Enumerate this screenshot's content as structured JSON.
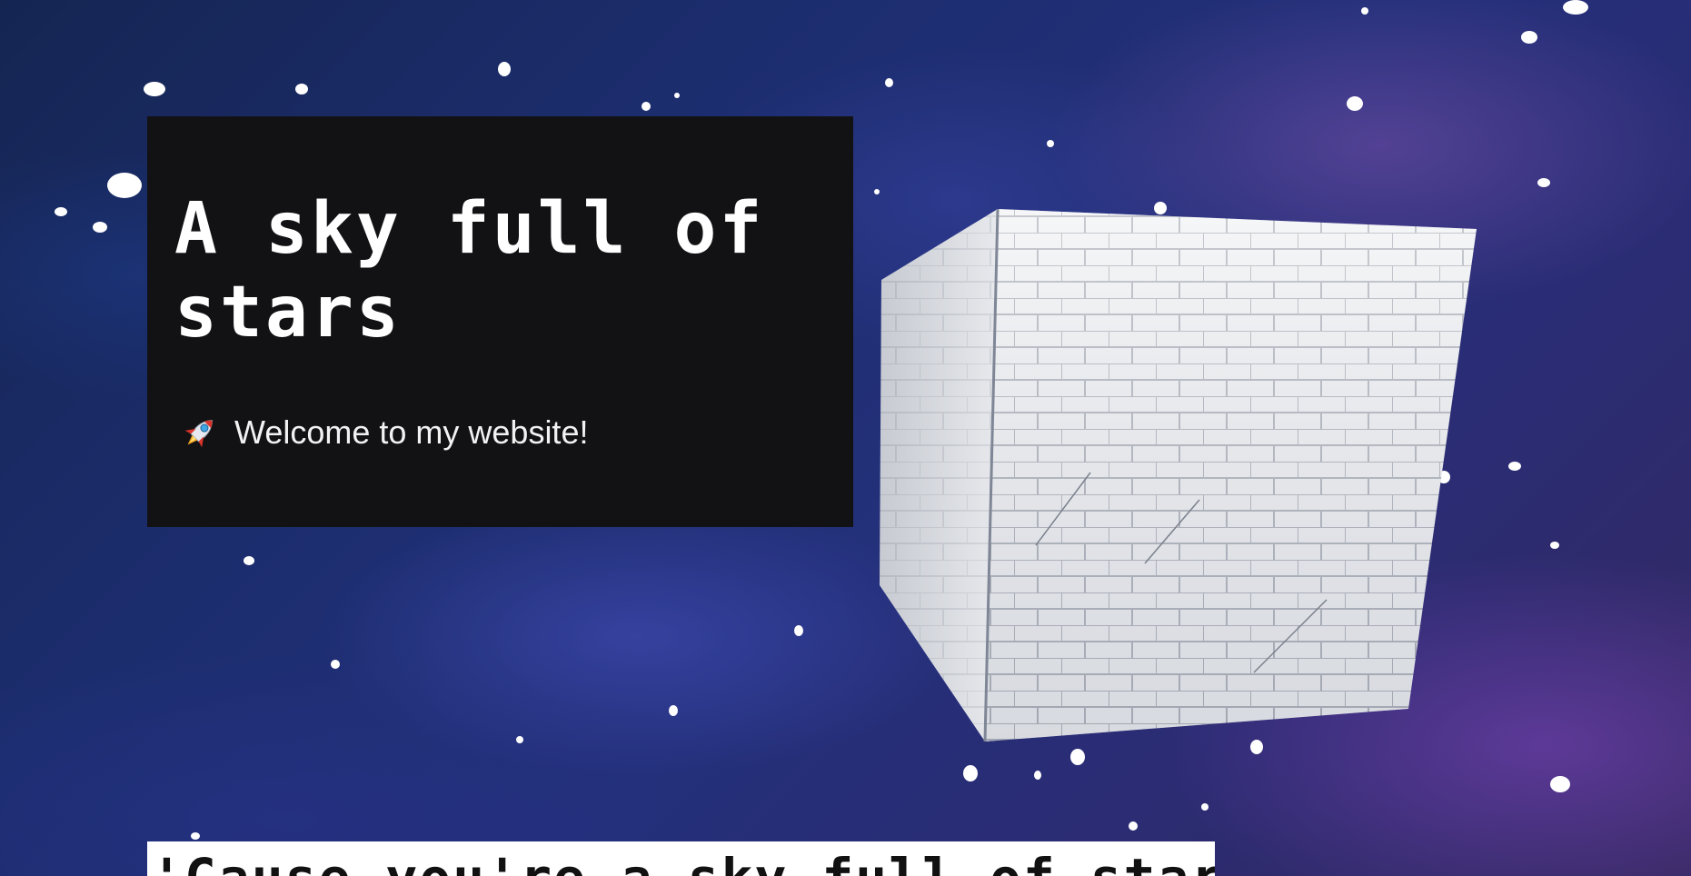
{
  "hero": {
    "title": "A sky full of stars",
    "welcome_icon": "rocket-icon",
    "welcome_text": "Welcome to my website!"
  },
  "tagline": {
    "text": "'Cause you're a sky full of stars"
  },
  "colors": {
    "card_background": "#121215",
    "space_background": "#1c2d6e",
    "text_light": "#ffffff"
  }
}
